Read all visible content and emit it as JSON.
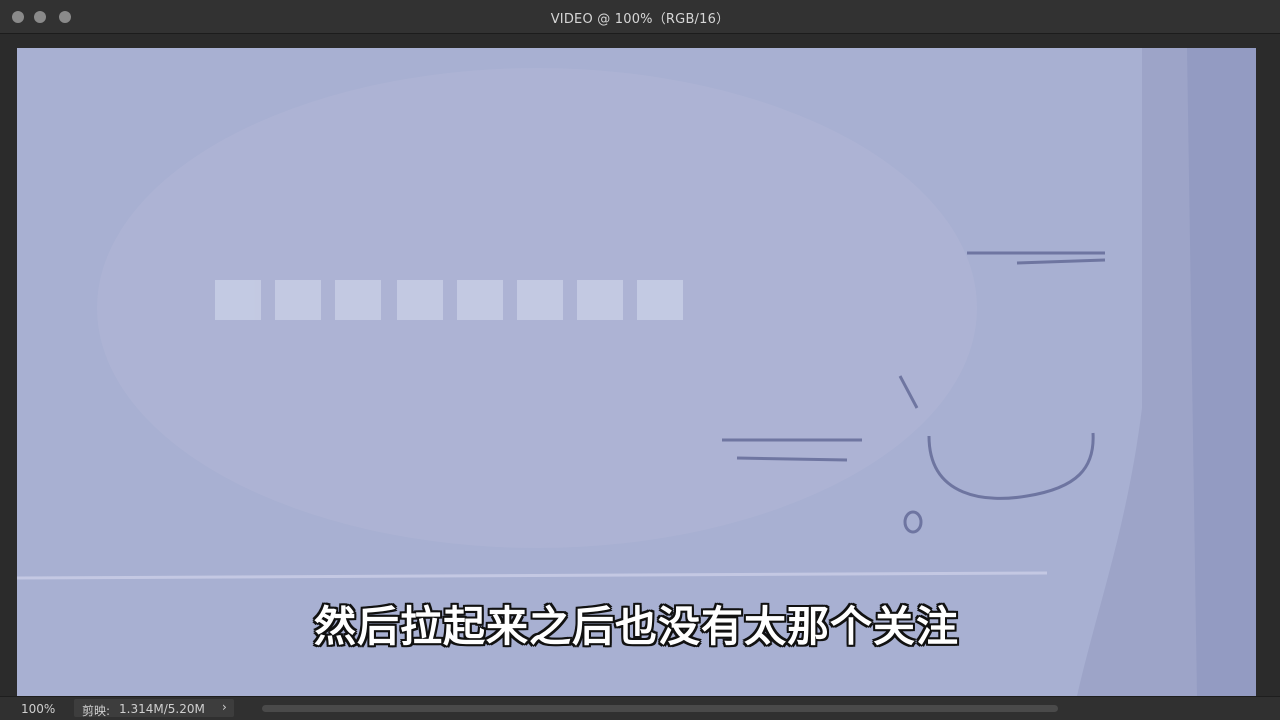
{
  "window": {
    "title": "VIDEO @ 100%（RGB/16）"
  },
  "canvas": {
    "background": "#a8b0d2",
    "subtitle": "然后拉起来之后也没有太那个关注"
  },
  "statusbar": {
    "zoom": "100%",
    "doc_label": "剪映:",
    "doc_size": "1.314M/5.20M",
    "arrow": "›"
  }
}
